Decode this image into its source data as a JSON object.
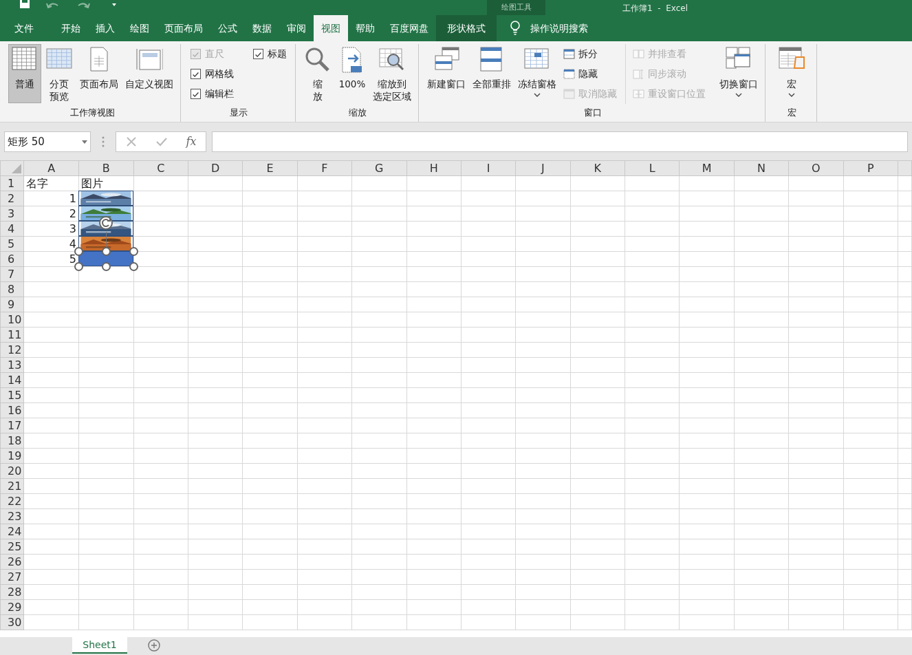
{
  "title_bar": {
    "context_label": "绘图工具",
    "title": "工作簿1  -  Excel"
  },
  "ribbon_tabs": [
    {
      "label": "文件",
      "selected": false,
      "kind": "normal"
    },
    {
      "label": "开始",
      "selected": false,
      "kind": "normal"
    },
    {
      "label": "插入",
      "selected": false,
      "kind": "normal"
    },
    {
      "label": "绘图",
      "selected": false,
      "kind": "normal"
    },
    {
      "label": "页面布局",
      "selected": false,
      "kind": "normal"
    },
    {
      "label": "公式",
      "selected": false,
      "kind": "normal"
    },
    {
      "label": "数据",
      "selected": false,
      "kind": "normal"
    },
    {
      "label": "审阅",
      "selected": false,
      "kind": "normal"
    },
    {
      "label": "视图",
      "selected": true,
      "kind": "normal"
    },
    {
      "label": "帮助",
      "selected": false,
      "kind": "normal"
    },
    {
      "label": "百度网盘",
      "selected": false,
      "kind": "normal"
    },
    {
      "label": "形状格式",
      "selected": false,
      "kind": "contextual"
    }
  ],
  "tell_me": "操作说明搜索",
  "ribbon_groups": [
    {
      "label": "工作簿视图",
      "items": [
        {
          "kind": "large",
          "label": "普通",
          "selected": true
        },
        {
          "kind": "large",
          "label_lines": [
            "分页",
            "预览"
          ],
          "selected": false
        },
        {
          "kind": "large",
          "label": "页面布局",
          "selected": false
        },
        {
          "kind": "large",
          "label": "自定义视图",
          "selected": false
        }
      ]
    },
    {
      "label": "显示",
      "items": [
        {
          "kind": "checks",
          "checks": [
            {
              "label": "直尺",
              "checked": true,
              "disabled": true
            },
            {
              "label": "网格线",
              "checked": true,
              "disabled": false
            },
            {
              "label": "编辑栏",
              "checked": true,
              "disabled": false
            }
          ]
        },
        {
          "kind": "checks",
          "checks": [
            {
              "label": "标题",
              "checked": true,
              "disabled": false
            }
          ]
        }
      ]
    },
    {
      "label": "缩放",
      "items": [
        {
          "kind": "large",
          "label_lines": [
            "缩",
            "放"
          ],
          "selected": false
        },
        {
          "kind": "large",
          "label": "100%",
          "selected": false
        },
        {
          "kind": "large",
          "label_lines": [
            "缩放到",
            "选定区域"
          ],
          "selected": false
        }
      ]
    },
    {
      "label": "窗口",
      "items": [
        {
          "kind": "large",
          "label": "新建窗口",
          "selected": false
        },
        {
          "kind": "large",
          "label": "全部重排",
          "selected": false
        },
        {
          "kind": "large",
          "label": "冻结窗格",
          "selected": false,
          "has_menu": true
        },
        {
          "kind": "smalls",
          "buttons": [
            {
              "label": "拆分",
              "disabled": false
            },
            {
              "label": "隐藏",
              "disabled": false
            },
            {
              "label": "取消隐藏",
              "disabled": true
            }
          ]
        },
        {
          "kind": "smalls",
          "buttons": [
            {
              "label": "并排查看",
              "disabled": true
            },
            {
              "label": "同步滚动",
              "disabled": true
            },
            {
              "label": "重设窗口位置",
              "disabled": true
            }
          ]
        },
        {
          "kind": "large",
          "label": "切换窗口",
          "selected": false,
          "has_menu": true
        }
      ]
    },
    {
      "label": "宏",
      "items": [
        {
          "kind": "large",
          "label": "宏",
          "selected": false,
          "has_menu": true
        }
      ]
    }
  ],
  "formula_bar": {
    "name_box": "矩形 50",
    "function_button": "fx"
  },
  "columns": [
    "A",
    "B",
    "C",
    "D",
    "E",
    "F",
    "G",
    "H",
    "I",
    "J",
    "K",
    "L",
    "M",
    "N",
    "O",
    "P"
  ],
  "rows": [
    {
      "header": "1",
      "cells": [
        {
          "text": "名字",
          "kind": "text"
        },
        {
          "text": "图片",
          "kind": "text"
        }
      ]
    },
    {
      "header": "2",
      "cells": [
        {
          "text": "1",
          "kind": "number"
        }
      ]
    },
    {
      "header": "3",
      "cells": [
        {
          "text": "2",
          "kind": "number"
        }
      ]
    },
    {
      "header": "4",
      "cells": [
        {
          "text": "3",
          "kind": "number"
        }
      ]
    },
    {
      "header": "5",
      "cells": [
        {
          "text": "4",
          "kind": "number"
        }
      ]
    },
    {
      "header": "6",
      "cells": [
        {
          "text": "5",
          "kind": "number"
        }
      ]
    },
    {
      "header": "7"
    },
    {
      "header": "8"
    },
    {
      "header": "9"
    },
    {
      "header": "10"
    },
    {
      "header": "11"
    },
    {
      "header": "12"
    },
    {
      "header": "13"
    },
    {
      "header": "14"
    },
    {
      "header": "15"
    },
    {
      "header": "16"
    },
    {
      "header": "17"
    },
    {
      "header": "18"
    },
    {
      "header": "19"
    },
    {
      "header": "20"
    },
    {
      "header": "21"
    },
    {
      "header": "22"
    },
    {
      "header": "23"
    },
    {
      "header": "24"
    },
    {
      "header": "25"
    },
    {
      "header": "26"
    },
    {
      "header": "27"
    },
    {
      "header": "28"
    },
    {
      "header": "29"
    },
    {
      "header": "30"
    }
  ],
  "shapes": [
    {
      "kind": "picture"
    },
    {
      "kind": "picture"
    },
    {
      "kind": "picture"
    },
    {
      "kind": "picture"
    },
    {
      "kind": "rectangle",
      "selected": true
    }
  ],
  "sheet_tabs": [
    {
      "label": "Sheet1",
      "selected": true
    }
  ]
}
